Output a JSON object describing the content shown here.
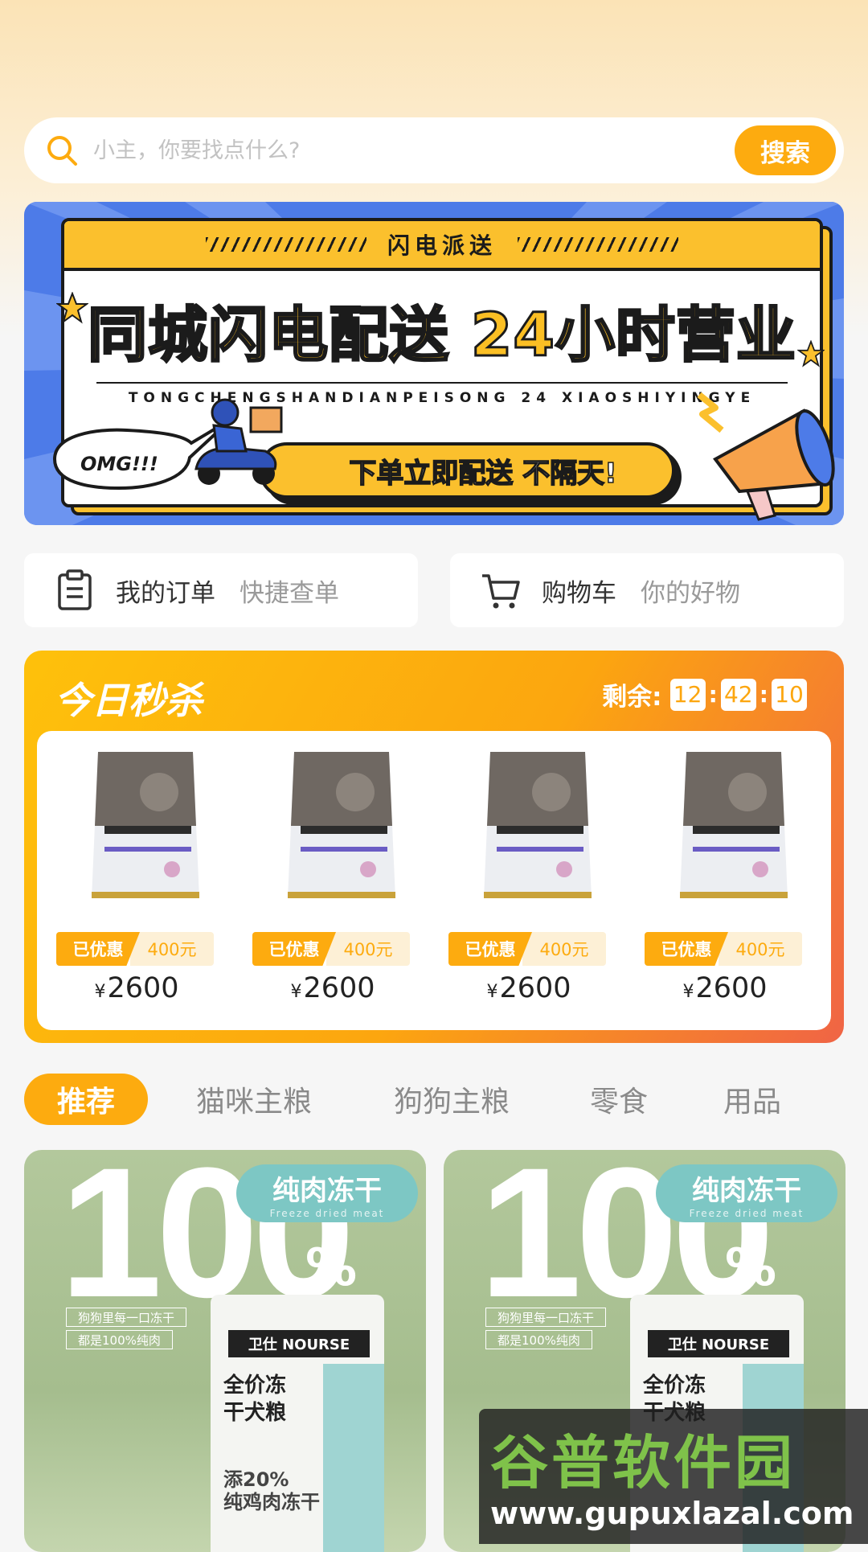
{
  "search": {
    "placeholder": "小主，你要找点什么?",
    "button_label": "搜索",
    "accent_color": "#fdab0f"
  },
  "banner": {
    "strip_text": "闪电派送",
    "headline": "同城闪电配送 24小时营业",
    "pinyin": "TONGCHENGSHANDIANPEISONG  24 XIAOSHIYINGYE",
    "pill_text": "下单立即配送 不隔天!",
    "bubble_text": "OMG!!!"
  },
  "quick_links": {
    "orders": {
      "label": "我的订单",
      "sub": "快捷查单",
      "icon": "clipboard-icon"
    },
    "cart": {
      "label": "购物车",
      "sub": "你的好物",
      "icon": "cart-icon"
    }
  },
  "flash_sale": {
    "title": "今日秒杀",
    "remaining_label": "剩余:",
    "countdown": {
      "hours": "12",
      "minutes": "42",
      "seconds": "10"
    },
    "items": [
      {
        "discount_label": "已优惠",
        "discount_value": "400元",
        "currency": "¥",
        "price": "2600"
      },
      {
        "discount_label": "已优惠",
        "discount_value": "400元",
        "currency": "¥",
        "price": "2600"
      },
      {
        "discount_label": "已优惠",
        "discount_value": "400元",
        "currency": "¥",
        "price": "2600"
      },
      {
        "discount_label": "已优惠",
        "discount_value": "400元",
        "currency": "¥",
        "price": "2600"
      }
    ]
  },
  "tabs": [
    {
      "label": "推荐",
      "active": true
    },
    {
      "label": "猫咪主粮",
      "active": false
    },
    {
      "label": "狗狗主粮",
      "active": false
    },
    {
      "label": "零食",
      "active": false
    },
    {
      "label": "用品",
      "active": false
    }
  ],
  "products": [
    {
      "big_text": "100",
      "percent": "%",
      "badge": "纯肉冻干",
      "badge_sub": "Freeze dried meat",
      "label1": "狗狗里每一口冻干",
      "label2": "都是100%纯肉",
      "brand": "卫仕 NOURSE",
      "bag_text": "全价冻\n干犬粮",
      "bag_text2": "添20%\n纯鸡肉冻干"
    },
    {
      "big_text": "100",
      "percent": "%",
      "badge": "纯肉冻干",
      "badge_sub": "Freeze dried meat",
      "label1": "狗狗里每一口冻干",
      "label2": "都是100%纯肉",
      "brand": "卫仕 NOURSE",
      "bag_text": "全价冻\n干犬粮",
      "bag_text2": ""
    }
  ],
  "watermark": {
    "title": "谷普软件园",
    "url": "www.gupuxlazal.com"
  }
}
